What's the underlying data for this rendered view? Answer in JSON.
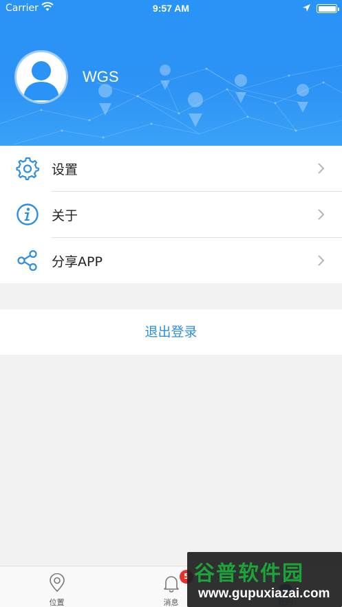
{
  "status_bar": {
    "carrier": "Carrier",
    "time": "9:57 AM"
  },
  "profile": {
    "username": "WGS"
  },
  "menu": {
    "items": [
      {
        "label": "设置",
        "icon": "gear-icon"
      },
      {
        "label": "关于",
        "icon": "info-icon"
      },
      {
        "label": "分享APP",
        "icon": "share-icon"
      }
    ]
  },
  "logout": {
    "label": "退出登录"
  },
  "tabbar": {
    "tabs": [
      {
        "label": "位置",
        "icon": "location-pin-icon"
      },
      {
        "label": "消息",
        "icon": "bell-icon",
        "badge": "5"
      },
      {
        "label": "我的",
        "icon": "profile-icon"
      }
    ]
  },
  "watermark": {
    "title": "谷普软件园",
    "url": "www.gupuxiazai.com"
  },
  "colors": {
    "header_blue": "#2a93f7",
    "accent": "#2e8ee0",
    "badge_red": "#e6322d"
  }
}
